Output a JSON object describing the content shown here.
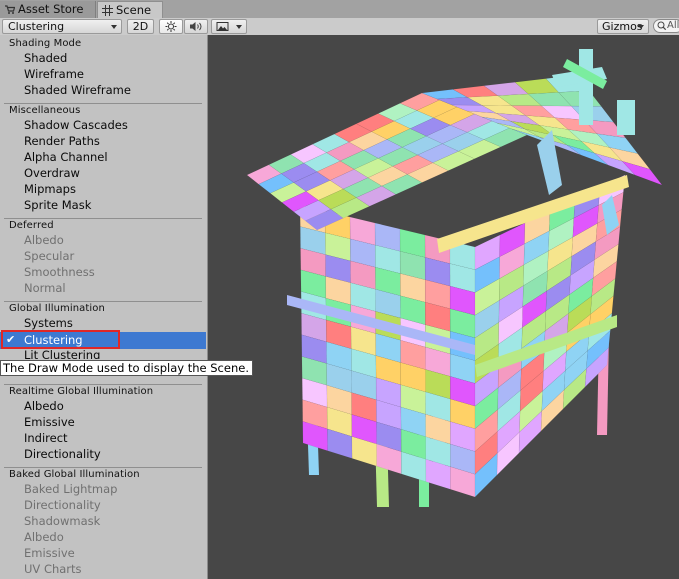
{
  "tabs": [
    {
      "label": "Asset Store",
      "icon": "cart-icon"
    },
    {
      "label": "Scene",
      "icon": "grid-icon"
    }
  ],
  "toolbar": {
    "draw_mode": "Clustering",
    "mode_2d": "2D",
    "gizmos": "Gizmos",
    "search_placeholder": "All"
  },
  "menu": {
    "sections": [
      {
        "title": "Shading Mode",
        "items": [
          "Shaded",
          "Wireframe",
          "Shaded Wireframe"
        ]
      },
      {
        "title": "Miscellaneous",
        "items": [
          "Shadow Cascades",
          "Render Paths",
          "Alpha Channel",
          "Overdraw",
          "Mipmaps",
          "Sprite Mask"
        ]
      },
      {
        "title": "Deferred",
        "items": [
          "Albedo",
          "Specular",
          "Smoothness",
          "Normal"
        ],
        "disabled": true
      },
      {
        "title": "Global Illumination",
        "items": [
          "Systems",
          "Clustering",
          "Lit Clustering"
        ],
        "selected": "Clustering"
      },
      {
        "title": "Realtime Global Illumination",
        "items": [
          "Albedo",
          "Emissive",
          "Indirect",
          "Directionality"
        ]
      },
      {
        "title": "Baked Global Illumination",
        "items": [
          "Baked Lightmap",
          "Directionality",
          "Shadowmask",
          "Albedo",
          "Emissive",
          "UV Charts"
        ],
        "disabled": true
      }
    ]
  },
  "tooltip": "The Draw Mode used to display the Scene.",
  "colors": {
    "selection": "#3d79d1",
    "highlight_box": "#e02727",
    "viewport_bg": "#474747"
  }
}
